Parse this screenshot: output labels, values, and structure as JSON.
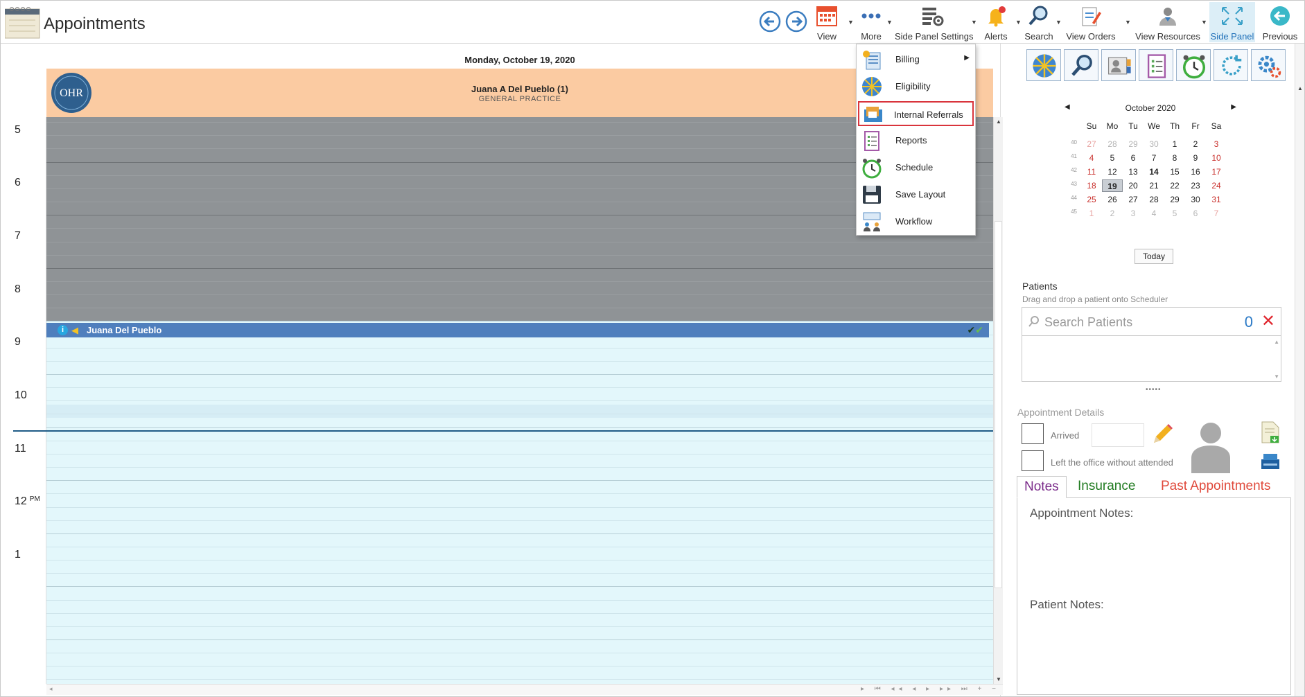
{
  "header": {
    "title": "Appointments",
    "toolbar": [
      {
        "key": "view",
        "label": "View",
        "icon": "calendar-icon"
      },
      {
        "key": "more",
        "label": "More",
        "icon": "more-dots-icon"
      },
      {
        "key": "side_panel_settings",
        "label": "Side Panel Settings",
        "icon": "panel-settings-icon"
      },
      {
        "key": "alerts",
        "label": "Alerts",
        "icon": "bell-icon"
      },
      {
        "key": "search",
        "label": "Search",
        "icon": "magnifier-icon"
      },
      {
        "key": "view_orders",
        "label": "View Orders",
        "icon": "orders-icon"
      },
      {
        "key": "view_resources",
        "label": "View Resources",
        "icon": "resources-icon"
      },
      {
        "key": "side_panel",
        "label": "Side Panel",
        "icon": "expand-icon",
        "active": true
      },
      {
        "key": "previous",
        "label": "Previous",
        "icon": "back-arrow-icon"
      }
    ]
  },
  "scheduler": {
    "date": "Monday, October 19, 2020",
    "resource_name": "Juana A Del Pueblo (1)",
    "resource_specialty": "GENERAL PRACTICE",
    "logo_text": "OHR",
    "hours": [
      "5",
      "6",
      "7",
      "8",
      "9",
      "10",
      "11",
      "12",
      "1"
    ],
    "pm_marker": "PM",
    "appointment": {
      "patient": "Juana Del Pueblo",
      "info": "i"
    }
  },
  "more_menu": {
    "items": [
      {
        "label": "Billing",
        "icon": "billing-icon",
        "submenu": true
      },
      {
        "label": "Eligibility",
        "icon": "eligibility-icon"
      },
      {
        "label": "Internal Referrals",
        "icon": "internal-referrals-icon",
        "highlighted": true
      },
      {
        "label": "Reports",
        "icon": "reports-icon"
      },
      {
        "label": "Schedule",
        "icon": "alarm-clock-icon"
      },
      {
        "label": "Save Layout",
        "icon": "floppy-disk-icon"
      },
      {
        "label": "Workflow",
        "icon": "workflow-icon"
      }
    ]
  },
  "side_panel": {
    "calendar": {
      "title": "October 2020",
      "weekdays": [
        "Su",
        "Mo",
        "Tu",
        "We",
        "Th",
        "Fr",
        "Sa"
      ],
      "weeks": [
        {
          "num": "40",
          "days": [
            "27",
            "28",
            "29",
            "30",
            "1",
            "2",
            "3"
          ]
        },
        {
          "num": "41",
          "days": [
            "4",
            "5",
            "6",
            "7",
            "8",
            "9",
            "10"
          ]
        },
        {
          "num": "42",
          "days": [
            "11",
            "12",
            "13",
            "14",
            "15",
            "16",
            "17"
          ]
        },
        {
          "num": "43",
          "days": [
            "18",
            "19",
            "20",
            "21",
            "22",
            "23",
            "24"
          ]
        },
        {
          "num": "44",
          "days": [
            "25",
            "26",
            "27",
            "28",
            "29",
            "30",
            "31"
          ]
        },
        {
          "num": "45",
          "days": [
            "1",
            "2",
            "3",
            "4",
            "5",
            "6",
            "7"
          ]
        }
      ],
      "selected_day": "19",
      "today_day": "14",
      "today_label": "Today"
    },
    "patients": {
      "title": "Patients",
      "hint": "Drag and drop a patient onto Scheduler",
      "search_placeholder": "Search Patients",
      "count": "0"
    },
    "appointment_details": {
      "title": "Appointment Details",
      "arrived_label": "Arrived",
      "left_label": "Left the office without attended"
    },
    "tabs": [
      "Notes",
      "Insurance",
      "Past Appointments"
    ],
    "notes": {
      "appointment_notes_label": "Appointment Notes:",
      "patient_notes_label": "Patient Notes:"
    }
  },
  "colors": {
    "resource_header": "#fbcba2",
    "blocked_time": "#8f9396",
    "open_time": "#e3f7fb",
    "appointment_bar": "#4f7fbd",
    "highlight_border": "#d9343c",
    "weekend_red": "#c9302c"
  }
}
